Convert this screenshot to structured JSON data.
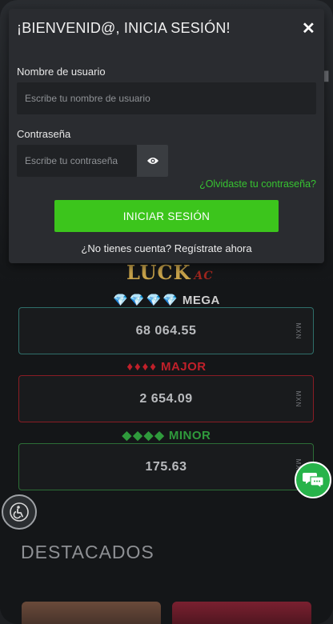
{
  "background": {
    "logo_text": "LUCK",
    "logo_sub": "AC",
    "jackpots": [
      {
        "name": "MEGA",
        "gems": "💎💎💎💎",
        "value": "68 064.55",
        "currency": "MXN",
        "color": "#cfcfcf"
      },
      {
        "name": "MAJOR",
        "gems": "♦♦♦♦",
        "value": "2 654.09",
        "currency": "MXN",
        "color": "#c0202a"
      },
      {
        "name": "MINOR",
        "gems": "◆◆◆◆",
        "value": "175.63",
        "currency": "MXN",
        "color": "#2f9a3c"
      }
    ],
    "section_title": "DESTACADOS"
  },
  "modal": {
    "title": "¡BIENVENID@, INICIA SESIÓN!",
    "close_icon": "close-icon",
    "username_label": "Nombre de usuario",
    "username_placeholder": "Escribe tu nombre de usuario",
    "username_value": "",
    "password_label": "Contraseña",
    "password_placeholder": "Escribe tu contraseña",
    "password_value": "",
    "toggle_icon": "eye-icon",
    "forgot_link": "¿Olvidaste tu contraseña?",
    "login_button": "INICIAR SESIÓN",
    "register_text": "¿No tienes cuenta? Regístrate ahora"
  },
  "floating": {
    "accessibility_icon": "accessibility-icon",
    "chat_icon": "chat-icon"
  },
  "colors": {
    "accent_green": "#3cc51c",
    "link_green": "#37c431",
    "modal_bg": "#2a2c30"
  }
}
